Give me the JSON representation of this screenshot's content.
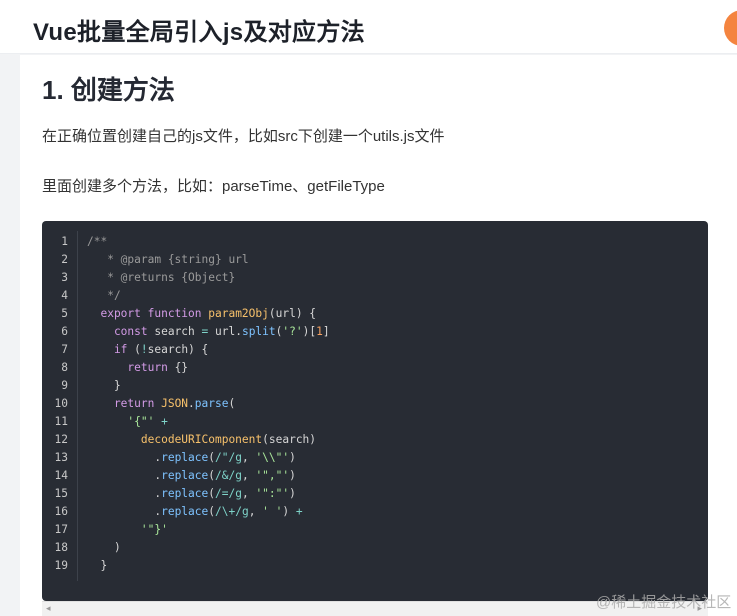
{
  "header": {
    "title": "Vue批量全局引入js及对应方法"
  },
  "article": {
    "heading": "1. 创建方法",
    "paragraph1": "在正确位置创建自己的js文件，比如src下创建一个utils.js文件",
    "paragraph2": "里面创建多个方法，比如：parseTime、getFileType"
  },
  "code": {
    "line_numbers": [
      "1",
      "2",
      "3",
      "4",
      "5",
      "6",
      "7",
      "8",
      "9",
      "10",
      "11",
      "12",
      "13",
      "14",
      "15",
      "16",
      "17",
      "18",
      "19"
    ],
    "lines": [
      [
        {
          "t": "/**",
          "c": "c-comment"
        }
      ],
      [
        {
          "t": "   * @param {string} url",
          "c": "c-comment"
        }
      ],
      [
        {
          "t": "   * @returns {Object}",
          "c": "c-comment"
        }
      ],
      [
        {
          "t": "   */",
          "c": "c-comment"
        }
      ],
      [
        {
          "t": "  export function ",
          "c": "c-kw"
        },
        {
          "t": "param2Obj",
          "c": "c-fn"
        },
        {
          "t": "(url) {",
          "c": "c-plain"
        }
      ],
      [
        {
          "t": "    const ",
          "c": "c-kw"
        },
        {
          "t": "search ",
          "c": "c-plain"
        },
        {
          "t": "= ",
          "c": "c-op"
        },
        {
          "t": "url.",
          "c": "c-plain"
        },
        {
          "t": "split",
          "c": "c-blue"
        },
        {
          "t": "(",
          "c": "c-plain"
        },
        {
          "t": "'?'",
          "c": "c-str"
        },
        {
          "t": ")[",
          "c": "c-plain"
        },
        {
          "t": "1",
          "c": "c-num"
        },
        {
          "t": "]",
          "c": "c-plain"
        }
      ],
      [
        {
          "t": "    if ",
          "c": "c-kw"
        },
        {
          "t": "(",
          "c": "c-plain"
        },
        {
          "t": "!",
          "c": "c-op"
        },
        {
          "t": "search) {",
          "c": "c-plain"
        }
      ],
      [
        {
          "t": "      return ",
          "c": "c-kw"
        },
        {
          "t": "{}",
          "c": "c-plain"
        }
      ],
      [
        {
          "t": "    }",
          "c": "c-plain"
        }
      ],
      [
        {
          "t": "    return ",
          "c": "c-kw"
        },
        {
          "t": "JSON",
          "c": "c-fn"
        },
        {
          "t": ".",
          "c": "c-plain"
        },
        {
          "t": "parse",
          "c": "c-blue"
        },
        {
          "t": "(",
          "c": "c-plain"
        }
      ],
      [
        {
          "t": "      '{\"' ",
          "c": "c-str"
        },
        {
          "t": "+",
          "c": "c-op"
        }
      ],
      [
        {
          "t": "        ",
          "c": "c-plain"
        },
        {
          "t": "decodeURIComponent",
          "c": "c-fn"
        },
        {
          "t": "(search)",
          "c": "c-plain"
        }
      ],
      [
        {
          "t": "          .",
          "c": "c-plain"
        },
        {
          "t": "replace",
          "c": "c-blue"
        },
        {
          "t": "(",
          "c": "c-plain"
        },
        {
          "t": "/\"/g",
          "c": "c-op"
        },
        {
          "t": ", ",
          "c": "c-plain"
        },
        {
          "t": "'\\\\\"'",
          "c": "c-str"
        },
        {
          "t": ")",
          "c": "c-plain"
        }
      ],
      [
        {
          "t": "          .",
          "c": "c-plain"
        },
        {
          "t": "replace",
          "c": "c-blue"
        },
        {
          "t": "(",
          "c": "c-plain"
        },
        {
          "t": "/&/g",
          "c": "c-op"
        },
        {
          "t": ", ",
          "c": "c-plain"
        },
        {
          "t": "'\",\"'",
          "c": "c-str"
        },
        {
          "t": ")",
          "c": "c-plain"
        }
      ],
      [
        {
          "t": "          .",
          "c": "c-plain"
        },
        {
          "t": "replace",
          "c": "c-blue"
        },
        {
          "t": "(",
          "c": "c-plain"
        },
        {
          "t": "/=/g",
          "c": "c-op"
        },
        {
          "t": ", ",
          "c": "c-plain"
        },
        {
          "t": "'\":\"'",
          "c": "c-str"
        },
        {
          "t": ")",
          "c": "c-plain"
        }
      ],
      [
        {
          "t": "          .",
          "c": "c-plain"
        },
        {
          "t": "replace",
          "c": "c-blue"
        },
        {
          "t": "(",
          "c": "c-plain"
        },
        {
          "t": "/\\+/g",
          "c": "c-op"
        },
        {
          "t": ", ",
          "c": "c-plain"
        },
        {
          "t": "' '",
          "c": "c-str"
        },
        {
          "t": ") ",
          "c": "c-plain"
        },
        {
          "t": "+",
          "c": "c-op"
        }
      ],
      [
        {
          "t": "        '\"}'",
          "c": "c-str"
        }
      ],
      [
        {
          "t": "    )",
          "c": "c-plain"
        }
      ],
      [
        {
          "t": "  }",
          "c": "c-plain"
        }
      ]
    ]
  },
  "watermark": "@稀土掘金技术社区",
  "scroll": {
    "left_arrow": "◂",
    "right_arrow": "▸"
  }
}
